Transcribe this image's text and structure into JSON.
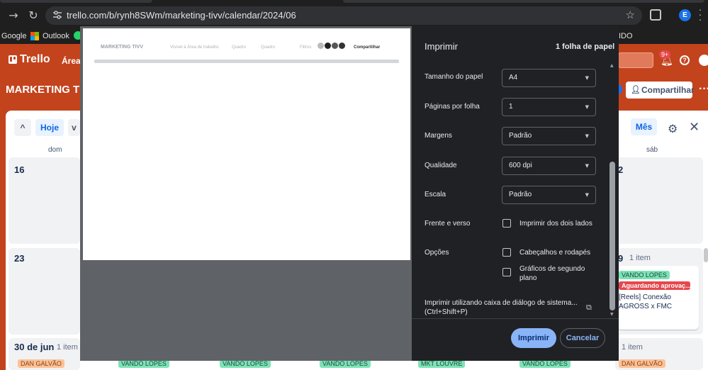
{
  "browser": {
    "url": "trello.com/b/rynh8SWm/marketing-tivv/calendar/2024/06",
    "profile_initial": "E",
    "bookmarks": [
      "Google",
      "Outlook"
    ],
    "bookmark_tail": "IDO"
  },
  "trello": {
    "app_name": "Trello",
    "nav_areas": "Áreas",
    "notifications_badge": "9+",
    "help_label": "?",
    "board_title": "MARKETING TIV",
    "share_label": "Compartilhar",
    "more_label": "···",
    "calendar": {
      "today_label": "Hoje",
      "month_label": "Mês",
      "weekday_sun": "dom",
      "weekday_sat": "sáb",
      "rows": [
        {
          "day_left": "16",
          "day_right": "2"
        },
        {
          "day_left": "23",
          "day_right": "9",
          "right_count": "1 item",
          "right_card": {
            "member": "VANDO LOPES",
            "status": "Aguardando aprovaç...",
            "text": "[Reels] Conexão AGROSS x FMC"
          }
        },
        {
          "day_left": "30 de jun",
          "left_count": "1 item",
          "right_count": "1 item"
        }
      ],
      "bottom_chips": [
        "DAN GALVÃO",
        "VANDO LOPES",
        "VANDO LOPES",
        "VANDO LOPES",
        "MKT LOUVRE",
        "VANDO LOPES",
        "DAN GALVÃO"
      ]
    }
  },
  "print_dialog": {
    "title": "Imprimir",
    "sheet_count": "1 folha de papel",
    "preview": {
      "board_title": "MARKETING TIVV",
      "visible_label": "Visível à Área de trabalho",
      "view1": "Quadro",
      "view2": "Quadro",
      "filters": "Filtros",
      "share": "Compartilhar"
    },
    "settings": [
      {
        "label": "Tamanho do papel",
        "value": "A4"
      },
      {
        "label": "Páginas por folha",
        "value": "1"
      },
      {
        "label": "Margens",
        "value": "Padrão"
      },
      {
        "label": "Qualidade",
        "value": "600 dpi"
      },
      {
        "label": "Escala",
        "value": "Padrão"
      }
    ],
    "duplex_label": "Frente e verso",
    "duplex_option": "Imprimir dos dois lados",
    "options_label": "Opções",
    "option_headers": "Cabeçalhos e rodapés",
    "option_background": "Gráficos de segundo plano",
    "system_dialog": "Imprimir utilizando caixa de diálogo de sistema... (Ctrl+Shift+P)",
    "print_button": "Imprimir",
    "cancel_button": "Cancelar"
  }
}
